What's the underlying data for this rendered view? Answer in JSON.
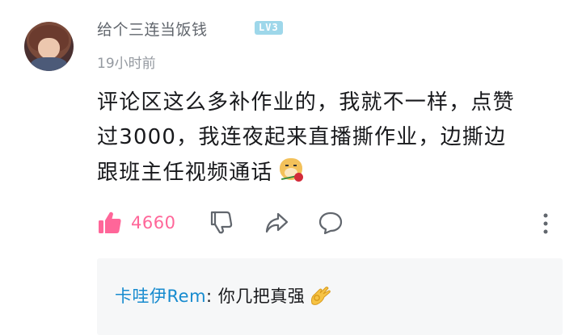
{
  "comment": {
    "avatar_icon": "user-avatar",
    "username": "给个三连当饭钱",
    "level_badge": "LV3",
    "timestamp": "19小时前",
    "content_lines": [
      "评论区这么多补作业的，我就不一样，点赞",
      "过3000，我连夜起来直播撕作业，边撕边",
      "跟班主任视频通话"
    ],
    "content_emoji": "doge-with-rose-emoji",
    "like_count": "4660",
    "icons": {
      "like": "thumbs-up-icon",
      "dislike": "thumbs-down-icon",
      "share": "share-icon",
      "reply": "comment-bubble-icon",
      "more": "more-vertical-icon"
    },
    "colors": {
      "like_active": "#ff6699",
      "reply_username": "#178bcf",
      "level_badge": "#9ed7ea",
      "text_primary": "#18191c",
      "text_secondary": "#9499a0"
    }
  },
  "reply_preview": {
    "username": "卡哇伊Rem",
    "separator": ":",
    "text": " 你几把真强",
    "emoji": "ok-hand-emoji"
  }
}
